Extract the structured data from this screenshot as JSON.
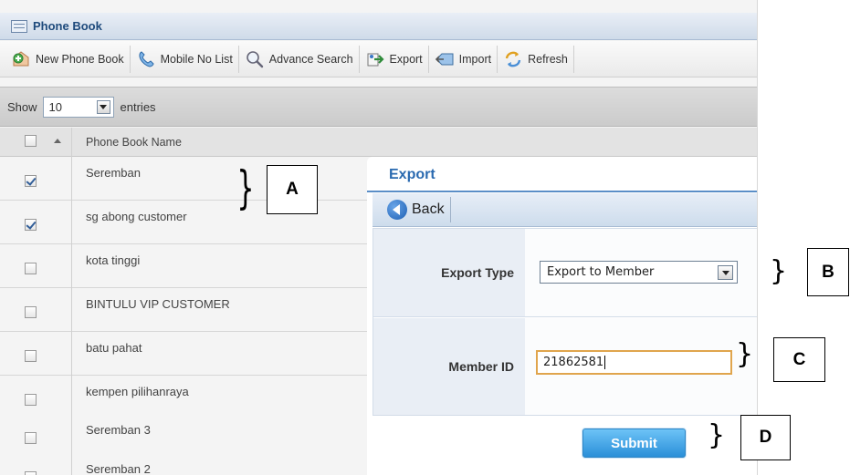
{
  "window": {
    "title": "Phone Book"
  },
  "toolbar": {
    "items": [
      {
        "label": "New Phone Book",
        "icon": "add-icon"
      },
      {
        "label": "Mobile No List",
        "icon": "phone-icon"
      },
      {
        "label": "Advance Search",
        "icon": "search-icon"
      },
      {
        "label": "Export",
        "icon": "export-icon"
      },
      {
        "label": "Import",
        "icon": "import-icon"
      },
      {
        "label": "Refresh",
        "icon": "refresh-icon"
      }
    ]
  },
  "list_controls": {
    "show_label": "Show",
    "entries_value": "10",
    "entries_label": "entries"
  },
  "table": {
    "column_header": "Phone Book Name",
    "rows": [
      {
        "name": "Seremban",
        "checked": true
      },
      {
        "name": "sg abong customer",
        "checked": true
      },
      {
        "name": "kota tinggi",
        "checked": false
      },
      {
        "name": "BINTULU VIP CUSTOMER",
        "checked": false
      },
      {
        "name": "batu pahat",
        "checked": false
      },
      {
        "name": "kempen pilihanraya",
        "checked": false
      },
      {
        "name": "Seremban 3",
        "checked": false
      },
      {
        "name": "Seremban 2",
        "checked": false
      }
    ]
  },
  "export_dialog": {
    "title": "Export",
    "back_label": "Back",
    "export_type_label": "Export Type",
    "export_type_value": "Export to Member",
    "member_id_label": "Member ID",
    "member_id_value": "21862581",
    "submit_label": "Submit"
  },
  "annotations": {
    "a": "A",
    "b": "B",
    "c": "C",
    "d": "D"
  }
}
